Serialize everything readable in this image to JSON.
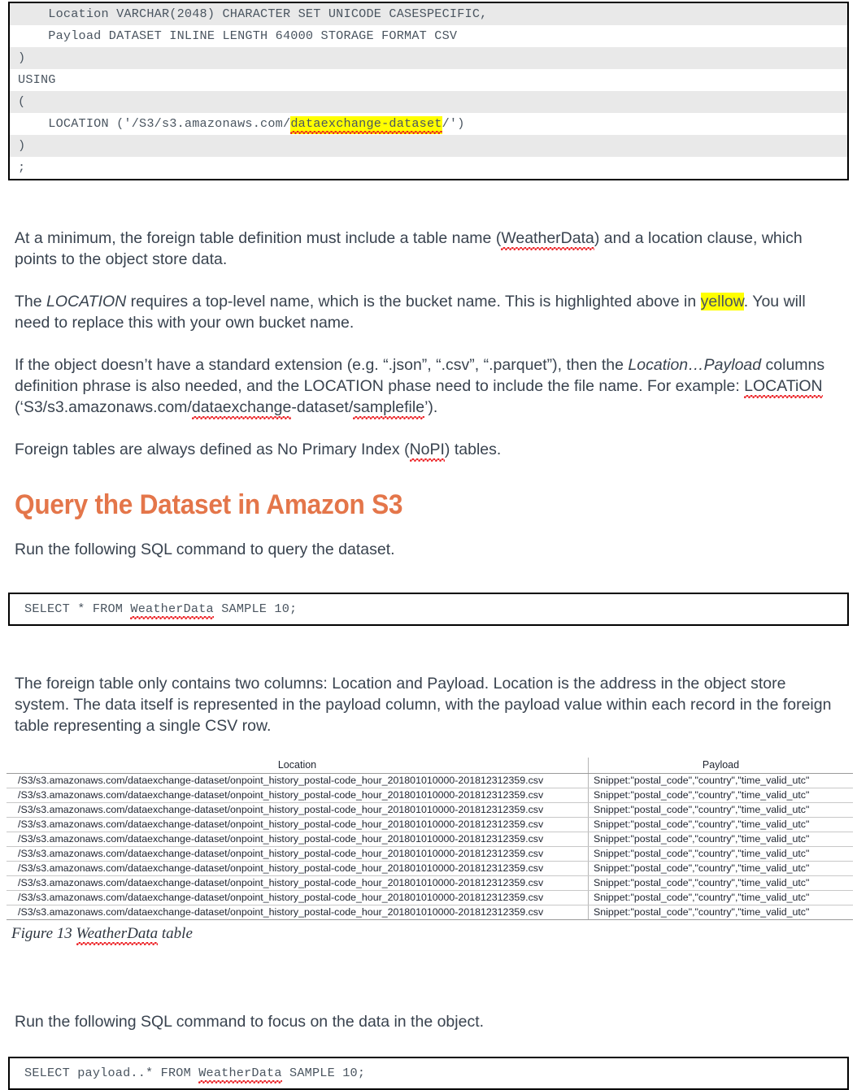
{
  "code_block_top": {
    "lines": [
      {
        "text": "    Location VARCHAR(2048) CHARACTER SET UNICODE CASESPECIFIC,",
        "shaded": true
      },
      {
        "text": "    Payload DATASET INLINE LENGTH 64000 STORAGE FORMAT CSV",
        "shaded": false
      },
      {
        "text": ")",
        "shaded": true
      },
      {
        "text": "USING",
        "shaded": false
      },
      {
        "text": "(",
        "shaded": true
      },
      {
        "text": "    LOCATION ('/S3/s3.amazonaws.com/dataexchange-dataset/')",
        "shaded": false
      },
      {
        "text": ")",
        "shaded": true
      },
      {
        "text": ";",
        "shaded": false
      }
    ],
    "location_line": {
      "prefix": "    LOCATION ('/S3/s3.amazonaws.com/",
      "highlight": "dataexchange-dataset",
      "suffix": "/')"
    }
  },
  "paragraphs": {
    "p1_a": "At a minimum, the foreign table definition must include a table name (",
    "p1_table": "WeatherData",
    "p1_b": ") and a location clause, which points to the object store data.",
    "p2_a": "The ",
    "p2_em": "LOCATION",
    "p2_b": " requires a top-level name, which is the bucket name. This is highlighted above in ",
    "p2_hl": "yellow",
    "p2_c": ". You will need to replace this with your own bucket name.",
    "p3_a": "If the object doesn’t have a standard extension (e.g. “.json”, “.csv”, “.parquet”), then the ",
    "p3_em": "Location…Payload",
    "p3_b": " columns definition phrase is also needed, and the LOCATION phase need to include the file name. For example: ",
    "p3_loc": "LOCATiON",
    "p3_c": " (‘S3/s3.amazonaws.com/",
    "p3_dx": "dataexchange",
    "p3_d": "-dataset/",
    "p3_sf": "samplefile",
    "p3_e": "’).",
    "p4_a": "Foreign tables are always defined as No Primary Index (",
    "p4_nopi": "NoPI",
    "p4_b": ") tables.",
    "p5": "Run the following SQL command to query the dataset.",
    "p6": "The foreign table only contains two columns: Location and Payload. Location is the address in the object store system. The data itself is represented in the payload column, with the payload value within each record in the foreign table representing a single CSV row.",
    "p7": "Run the following SQL command to focus on the data in the object."
  },
  "heading": {
    "query_dataset": "Query the Dataset in Amazon S3"
  },
  "sql_query_1": {
    "prefix": "SELECT * FROM ",
    "table": "WeatherData",
    "suffix": " SAMPLE 10;"
  },
  "sql_query_2": {
    "prefix": "SELECT payload..* FROM ",
    "table": "WeatherData",
    "suffix": " SAMPLE 10;"
  },
  "weather_table": {
    "headers": [
      "Location",
      "Payload"
    ],
    "rows": [
      [
        "/S3/s3.amazonaws.com/dataexchange-dataset/onpoint_history_postal-code_hour_201801010000-201812312359.csv",
        "Snippet:\"postal_code\",\"country\",\"time_valid_utc\""
      ],
      [
        "/S3/s3.amazonaws.com/dataexchange-dataset/onpoint_history_postal-code_hour_201801010000-201812312359.csv",
        "Snippet:\"postal_code\",\"country\",\"time_valid_utc\""
      ],
      [
        "/S3/s3.amazonaws.com/dataexchange-dataset/onpoint_history_postal-code_hour_201801010000-201812312359.csv",
        "Snippet:\"postal_code\",\"country\",\"time_valid_utc\""
      ],
      [
        "/S3/s3.amazonaws.com/dataexchange-dataset/onpoint_history_postal-code_hour_201801010000-201812312359.csv",
        "Snippet:\"postal_code\",\"country\",\"time_valid_utc\""
      ],
      [
        "/S3/s3.amazonaws.com/dataexchange-dataset/onpoint_history_postal-code_hour_201801010000-201812312359.csv",
        "Snippet:\"postal_code\",\"country\",\"time_valid_utc\""
      ],
      [
        "/S3/s3.amazonaws.com/dataexchange-dataset/onpoint_history_postal-code_hour_201801010000-201812312359.csv",
        "Snippet:\"postal_code\",\"country\",\"time_valid_utc\""
      ],
      [
        "/S3/s3.amazonaws.com/dataexchange-dataset/onpoint_history_postal-code_hour_201801010000-201812312359.csv",
        "Snippet:\"postal_code\",\"country\",\"time_valid_utc\""
      ],
      [
        "/S3/s3.amazonaws.com/dataexchange-dataset/onpoint_history_postal-code_hour_201801010000-201812312359.csv",
        "Snippet:\"postal_code\",\"country\",\"time_valid_utc\""
      ],
      [
        "/S3/s3.amazonaws.com/dataexchange-dataset/onpoint_history_postal-code_hour_201801010000-201812312359.csv",
        "Snippet:\"postal_code\",\"country\",\"time_valid_utc\""
      ],
      [
        "/S3/s3.amazonaws.com/dataexchange-dataset/onpoint_history_postal-code_hour_201801010000-201812312359.csv",
        "Snippet:\"postal_code\",\"country\",\"time_valid_utc\""
      ]
    ]
  },
  "figure_caption": {
    "prefix": "Figure 13 ",
    "table": "WeatherData",
    "suffix": " table"
  },
  "colors": {
    "heading_orange": "#e4764a",
    "body_text": "#39434f",
    "code_text": "#4a5560",
    "highlight_yellow": "#ffff00",
    "spellcheck_red": "#ec2024",
    "code_shade": "#e9e9e9",
    "border_black": "#000000"
  }
}
